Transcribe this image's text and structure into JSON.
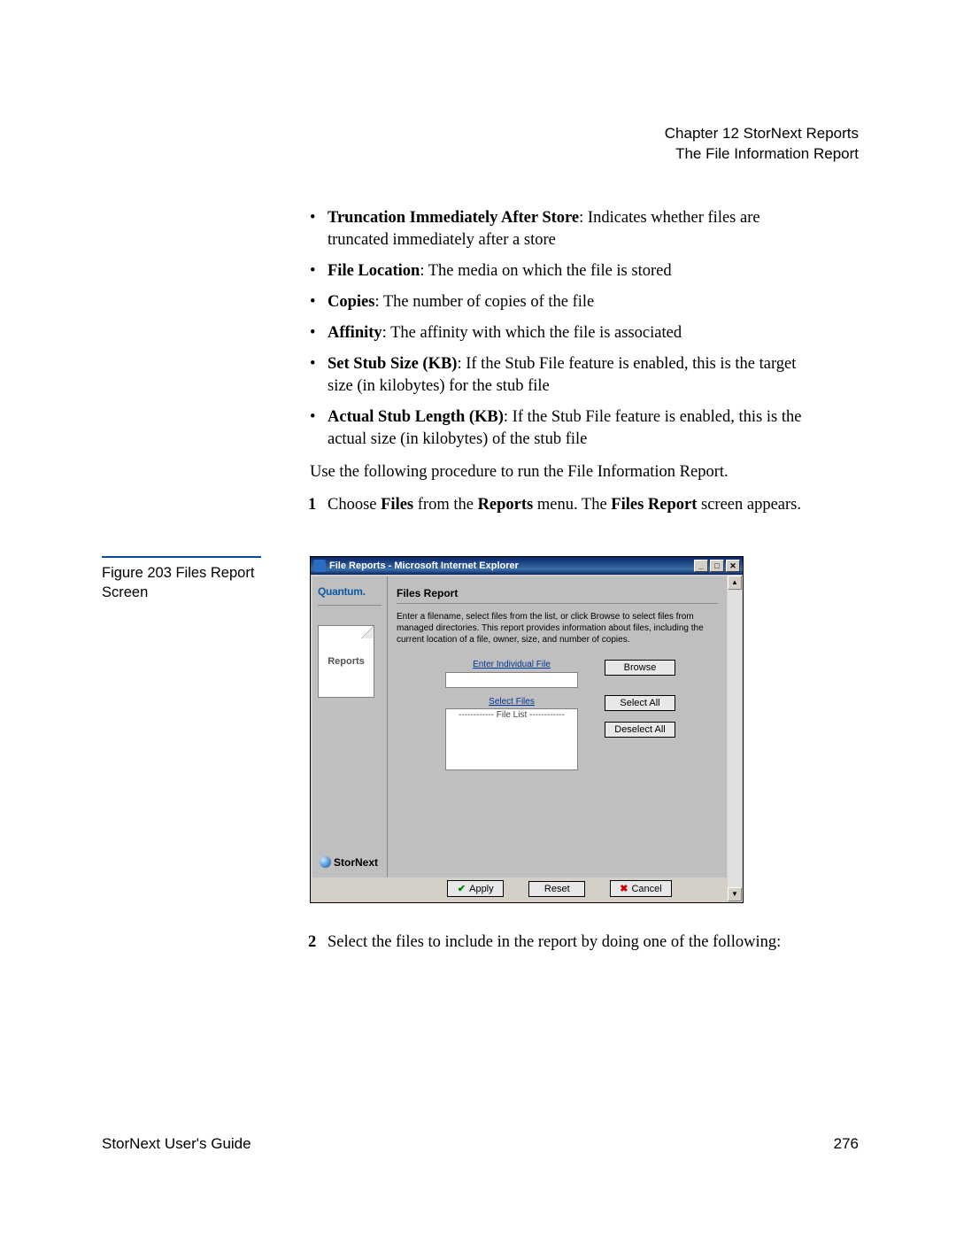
{
  "header": {
    "chapter": "Chapter 12  StorNext Reports",
    "section": "The File Information Report"
  },
  "bullets": [
    {
      "term": "Truncation Immediately After Store",
      "desc": ": Indicates whether files are truncated immediately after a store"
    },
    {
      "term": "File Location",
      "desc": ": The media on which the file is stored"
    },
    {
      "term": "Copies",
      "desc": ": The number of copies of the file"
    },
    {
      "term": "Affinity",
      "desc": ": The affinity with which the file is associated"
    },
    {
      "term": "Set Stub Size (KB)",
      "desc": ": If the Stub File feature is enabled, this is the target size (in kilobytes) for the stub file"
    },
    {
      "term": "Actual Stub Length (KB)",
      "desc": ": If the Stub File feature is enabled, this is the actual size (in kilobytes) of the stub file"
    }
  ],
  "para_intro": "Use the following procedure to run the File Information Report.",
  "step1": {
    "num": "1",
    "pre": "Choose ",
    "b1": "Files",
    "mid1": " from the ",
    "b2": "Reports",
    "mid2": " menu. The ",
    "b3": "Files Report",
    "post": " screen appears."
  },
  "figure": {
    "label": "Figure 203  Files Report Screen"
  },
  "screenshot": {
    "title": "File Reports - Microsoft Internet Explorer",
    "brand": "Quantum.",
    "tab": "Reports",
    "product": "StorNext",
    "panel_title": "Files Report",
    "panel_desc": "Enter a filename, select files from the list, or click Browse to select files from managed directories. This report provides information about files, including the current location of a file, owner, size, and number of copies.",
    "label_individual": "Enter Individual File",
    "label_select": "Select Files",
    "filelist_placeholder": "------------ File List ------------",
    "btn_browse": "Browse",
    "btn_selectall": "Select All",
    "btn_deselectall": "Deselect All",
    "btn_apply": "Apply",
    "btn_reset": "Reset",
    "btn_cancel": "Cancel",
    "win_min": "_",
    "win_max": "□",
    "win_close": "✕",
    "scroll_up": "▲",
    "scroll_down": "▼"
  },
  "step2": {
    "num": "2",
    "text": "Select the files to include in the report by doing one of the following:"
  },
  "footer": {
    "left": "StorNext User's Guide",
    "right": "276"
  }
}
